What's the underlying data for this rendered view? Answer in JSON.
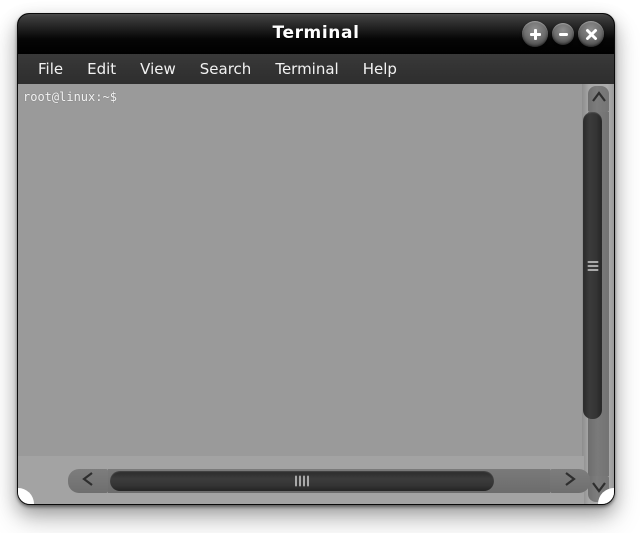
{
  "window": {
    "title": "Terminal",
    "buttons": [
      {
        "name": "maximize-button",
        "icon": "plus-icon",
        "label": "+"
      },
      {
        "name": "minimize-button",
        "icon": "minus-icon",
        "label": "−"
      },
      {
        "name": "close-button",
        "icon": "close-icon",
        "label": "✕"
      }
    ]
  },
  "menubar": {
    "items": [
      {
        "label": "File"
      },
      {
        "label": "Edit"
      },
      {
        "label": "View"
      },
      {
        "label": "Search"
      },
      {
        "label": "Terminal"
      },
      {
        "label": "Help"
      }
    ]
  },
  "terminal": {
    "lines": [
      "root@linux:~$"
    ],
    "prompt": "root@linux:~$",
    "background_color": "#9a9a9a",
    "text_color": "#f4f4f4"
  },
  "scrollbars": {
    "vertical": {
      "up_arrow_icon": "chevron-up-icon",
      "down_arrow_icon": "chevron-down-icon",
      "thumb_grip_lines": 3
    },
    "horizontal": {
      "left_arrow_icon": "chevron-left-icon",
      "right_arrow_icon": "chevron-right-icon",
      "thumb_grip_lines": 4
    }
  },
  "colors": {
    "titlebar_top": "#4a4a4a",
    "titlebar_bottom": "#000000",
    "menubar": "#333333",
    "terminal_bg": "#9a9a9a",
    "frame_bg": "#a3a3a3",
    "scroll_thumb": "#323232",
    "desktop": "#ffffff"
  }
}
